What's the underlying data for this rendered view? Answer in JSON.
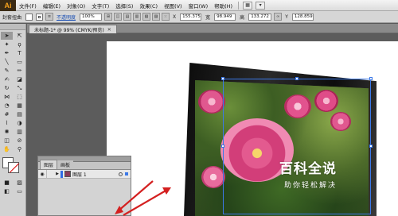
{
  "app": {
    "logo": "Ai",
    "menus": [
      "文件(F)",
      "编辑(E)",
      "对象(O)",
      "文字(T)",
      "选择(S)",
      "效果(C)",
      "视图(V)",
      "窗口(W)",
      "帮助(H)"
    ]
  },
  "controlbar": {
    "group_label": "封套扭曲",
    "opacity_link": "不透明度",
    "opacity_value": "100%",
    "x_label": "X",
    "x_value": "155.375",
    "w_label": "宽",
    "w_value": "98.949",
    "h_label": "高",
    "h_value": "133.272",
    "y_label": "Y",
    "y_value": "128.859"
  },
  "document": {
    "tab_title": "未标题-1* @ 99% (CMYK/预览)"
  },
  "layers_panel": {
    "tabs": [
      "图层",
      "画板"
    ],
    "layer_name": "图层 1"
  },
  "watermark": {
    "title": "百科全说",
    "subtitle": "助你轻松解决"
  },
  "colors": {
    "arrow": "#d42020",
    "selection": "#3b78e7",
    "layer_color": "#2f6be5"
  }
}
